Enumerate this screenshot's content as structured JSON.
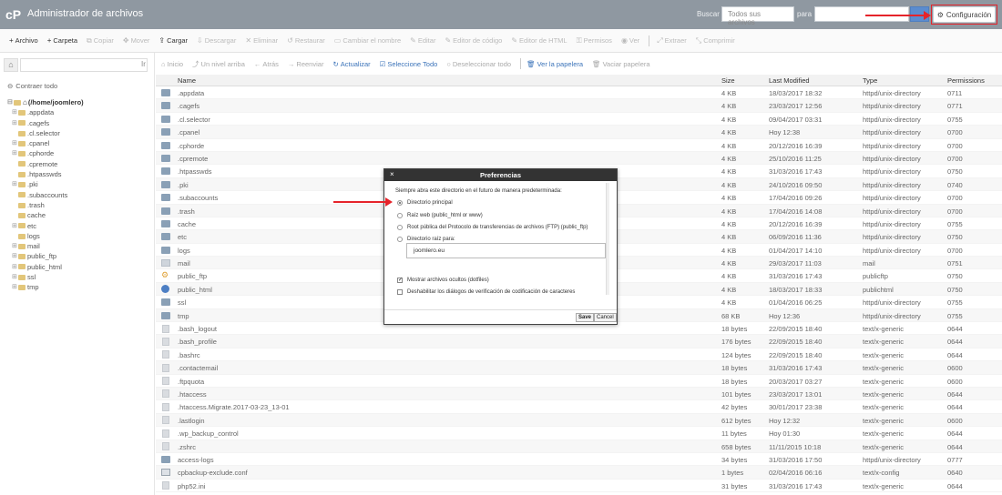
{
  "header": {
    "title": "Administrador de archivos",
    "search_label": "Buscar",
    "search_scope": "Todos sus archivos",
    "search_for_label": "para",
    "settings_label": "Configuración"
  },
  "toolbar": {
    "items": [
      {
        "label": "Archivo",
        "icon": "+",
        "enabled": true
      },
      {
        "label": "Carpeta",
        "icon": "+",
        "enabled": true
      },
      {
        "label": "Copiar",
        "icon": "⧉",
        "enabled": false
      },
      {
        "label": "Mover",
        "icon": "✥",
        "enabled": false
      },
      {
        "label": "Cargar",
        "icon": "⇪",
        "enabled": true
      },
      {
        "label": "Descargar",
        "icon": "⇩",
        "enabled": false
      },
      {
        "label": "Eliminar",
        "icon": "✕",
        "enabled": false
      },
      {
        "label": "Restaurar",
        "icon": "↺",
        "enabled": false
      },
      {
        "label": "Cambiar el nombre",
        "icon": "▭",
        "enabled": false
      },
      {
        "label": "Editar",
        "icon": "✎",
        "enabled": false
      },
      {
        "label": "Editor de código",
        "icon": "✎",
        "enabled": false
      },
      {
        "label": "Editor de HTML",
        "icon": "✎",
        "enabled": false
      },
      {
        "label": "Permisos",
        "icon": "⚿",
        "enabled": false
      },
      {
        "label": "Ver",
        "icon": "◉",
        "enabled": false
      },
      {
        "label": "Extraer",
        "icon": "⤢",
        "enabled": false
      },
      {
        "label": "Comprimir",
        "icon": "⤡",
        "enabled": false
      }
    ]
  },
  "sidebar": {
    "path_go": "Ir",
    "collapse_all": "Contraer todo",
    "root": "(/home/joomlero)",
    "tree": [
      {
        "label": ".appdata",
        "expandable": true
      },
      {
        "label": ".cagefs",
        "expandable": true
      },
      {
        "label": ".cl.selector",
        "expandable": false
      },
      {
        "label": ".cpanel",
        "expandable": true
      },
      {
        "label": ".cphorde",
        "expandable": true
      },
      {
        "label": ".cpremote",
        "expandable": false
      },
      {
        "label": ".htpasswds",
        "expandable": false
      },
      {
        "label": ".pki",
        "expandable": true
      },
      {
        "label": ".subaccounts",
        "expandable": false
      },
      {
        "label": ".trash",
        "expandable": false
      },
      {
        "label": "cache",
        "expandable": false
      },
      {
        "label": "etc",
        "expandable": true
      },
      {
        "label": "logs",
        "expandable": false
      },
      {
        "label": "mail",
        "expandable": true
      },
      {
        "label": "public_ftp",
        "expandable": true
      },
      {
        "label": "public_html",
        "expandable": true
      },
      {
        "label": "ssl",
        "expandable": true
      },
      {
        "label": "tmp",
        "expandable": true
      }
    ]
  },
  "nav": {
    "items": [
      {
        "label": "Inicio",
        "icon": "⌂",
        "enabled": false
      },
      {
        "label": "Un nivel arriba",
        "icon": "⤴",
        "enabled": false
      },
      {
        "label": "Atrás",
        "icon": "←",
        "enabled": false
      },
      {
        "label": "Reenviar",
        "icon": "→",
        "enabled": false
      },
      {
        "label": "Actualizar",
        "icon": "↻",
        "enabled": true
      },
      {
        "label": "Seleccione Todo",
        "icon": "☑",
        "enabled": true
      },
      {
        "label": "Deseleccionar todo",
        "icon": "○",
        "enabled": false
      },
      {
        "label": "Ver la papelera",
        "icon": "🗑",
        "enabled": true
      },
      {
        "label": "Vaciar papelera",
        "icon": "🗑",
        "enabled": false
      }
    ]
  },
  "table": {
    "headers": {
      "name": "Name",
      "size": "Size",
      "modified": "Last Modified",
      "type": "Type",
      "perms": "Permissions"
    },
    "rows": [
      {
        "icon": "folder",
        "name": ".appdata",
        "size": "4 KB",
        "modified": "18/03/2017 18:32",
        "type": "httpd/unix-directory",
        "perms": "0711"
      },
      {
        "icon": "folder",
        "name": ".cagefs",
        "size": "4 KB",
        "modified": "23/03/2017 12:56",
        "type": "httpd/unix-directory",
        "perms": "0771"
      },
      {
        "icon": "folder",
        "name": ".cl.selector",
        "size": "4 KB",
        "modified": "09/04/2017 03:31",
        "type": "httpd/unix-directory",
        "perms": "0755"
      },
      {
        "icon": "folder",
        "name": ".cpanel",
        "size": "4 KB",
        "modified": "Hoy 12:38",
        "type": "httpd/unix-directory",
        "perms": "0700"
      },
      {
        "icon": "folder",
        "name": ".cphorde",
        "size": "4 KB",
        "modified": "20/12/2016 16:39",
        "type": "httpd/unix-directory",
        "perms": "0700"
      },
      {
        "icon": "folder",
        "name": ".cpremote",
        "size": "4 KB",
        "modified": "25/10/2016 11:25",
        "type": "httpd/unix-directory",
        "perms": "0700"
      },
      {
        "icon": "folder",
        "name": ".htpasswds",
        "size": "4 KB",
        "modified": "31/03/2016 17:43",
        "type": "httpd/unix-directory",
        "perms": "0750"
      },
      {
        "icon": "folder",
        "name": ".pki",
        "size": "4 KB",
        "modified": "24/10/2016 09:50",
        "type": "httpd/unix-directory",
        "perms": "0740"
      },
      {
        "icon": "folder",
        "name": ".subaccounts",
        "size": "4 KB",
        "modified": "17/04/2016 09:26",
        "type": "httpd/unix-directory",
        "perms": "0700"
      },
      {
        "icon": "folder",
        "name": ".trash",
        "size": "4 KB",
        "modified": "17/04/2016 14:08",
        "type": "httpd/unix-directory",
        "perms": "0700"
      },
      {
        "icon": "folder",
        "name": "cache",
        "size": "4 KB",
        "modified": "20/12/2016 16:39",
        "type": "httpd/unix-directory",
        "perms": "0755"
      },
      {
        "icon": "folder",
        "name": "etc",
        "size": "4 KB",
        "modified": "06/09/2016 11:36",
        "type": "httpd/unix-directory",
        "perms": "0750"
      },
      {
        "icon": "folder",
        "name": "logs",
        "size": "4 KB",
        "modified": "01/04/2017 14:10",
        "type": "httpd/unix-directory",
        "perms": "0700"
      },
      {
        "icon": "mail",
        "name": "mail",
        "size": "4 KB",
        "modified": "29/03/2017 11:03",
        "type": "mail",
        "perms": "0751"
      },
      {
        "icon": "ftp",
        "name": "public_ftp",
        "size": "4 KB",
        "modified": "31/03/2016 17:43",
        "type": "publicftp",
        "perms": "0750"
      },
      {
        "icon": "globe",
        "name": "public_html",
        "size": "4 KB",
        "modified": "18/03/2017 18:33",
        "type": "publichtml",
        "perms": "0750"
      },
      {
        "icon": "folder",
        "name": "ssl",
        "size": "4 KB",
        "modified": "01/04/2016 06:25",
        "type": "httpd/unix-directory",
        "perms": "0755"
      },
      {
        "icon": "folder",
        "name": "tmp",
        "size": "68 KB",
        "modified": "Hoy 12:36",
        "type": "httpd/unix-directory",
        "perms": "0755"
      },
      {
        "icon": "file",
        "name": ".bash_logout",
        "size": "18 bytes",
        "modified": "22/09/2015 18:40",
        "type": "text/x-generic",
        "perms": "0644"
      },
      {
        "icon": "file",
        "name": ".bash_profile",
        "size": "176 bytes",
        "modified": "22/09/2015 18:40",
        "type": "text/x-generic",
        "perms": "0644"
      },
      {
        "icon": "file",
        "name": ".bashrc",
        "size": "124 bytes",
        "modified": "22/09/2015 18:40",
        "type": "text/x-generic",
        "perms": "0644"
      },
      {
        "icon": "file",
        "name": ".contactemail",
        "size": "18 bytes",
        "modified": "31/03/2016 17:43",
        "type": "text/x-generic",
        "perms": "0600"
      },
      {
        "icon": "file",
        "name": ".ftpquota",
        "size": "18 bytes",
        "modified": "20/03/2017 03:27",
        "type": "text/x-generic",
        "perms": "0600"
      },
      {
        "icon": "file",
        "name": ".htaccess",
        "size": "101 bytes",
        "modified": "23/03/2017 13:01",
        "type": "text/x-generic",
        "perms": "0644"
      },
      {
        "icon": "file",
        "name": ".htaccess.Migrate.2017-03-23_13-01",
        "size": "42 bytes",
        "modified": "30/01/2017 23:38",
        "type": "text/x-generic",
        "perms": "0644"
      },
      {
        "icon": "file",
        "name": ".lastlogin",
        "size": "612 bytes",
        "modified": "Hoy 12:32",
        "type": "text/x-generic",
        "perms": "0600"
      },
      {
        "icon": "file",
        "name": ".wp_backup_control",
        "size": "11 bytes",
        "modified": "Hoy 01:30",
        "type": "text/x-generic",
        "perms": "0644"
      },
      {
        "icon": "file",
        "name": ".zshrc",
        "size": "658 bytes",
        "modified": "11/11/2015 10:18",
        "type": "text/x-generic",
        "perms": "0644"
      },
      {
        "icon": "folder",
        "name": "access-logs",
        "size": "34 bytes",
        "modified": "31/03/2016 17:50",
        "type": "httpd/unix-directory",
        "perms": "0777"
      },
      {
        "icon": "cfg",
        "name": "cpbackup-exclude.conf",
        "size": "1 bytes",
        "modified": "02/04/2016 06:16",
        "type": "text/x-config",
        "perms": "0640"
      },
      {
        "icon": "file",
        "name": "php52.ini",
        "size": "31 bytes",
        "modified": "31/03/2016 17:43",
        "type": "text/x-generic",
        "perms": "0644"
      }
    ]
  },
  "modal": {
    "title": "Preferencias",
    "intro": "Siempre abra este directorio en el futuro de manera predeterminada:",
    "options": [
      {
        "label": "Directorio principal",
        "selected": true
      },
      {
        "label": "Raíz web (public_html or www)",
        "selected": false
      },
      {
        "label": "Root pública del Protocolo de transferencias de archivos (FTP) (public_ftp)",
        "selected": false
      },
      {
        "label": "Directorio raíz para:",
        "selected": false
      }
    ],
    "domain_value": "joomlero.eu",
    "checks": [
      {
        "label": "Mostrar archivos ocultos (dotfiles)",
        "checked": true
      },
      {
        "label": "Deshabilitar los diálogos de verificación de codificación de caracteres",
        "checked": false
      }
    ],
    "save_label": "Save",
    "cancel_label": "Cancel"
  },
  "colors": {
    "header_bg": "#8f98a1",
    "accent": "#3b73b9",
    "annotation": "#e5232a"
  }
}
